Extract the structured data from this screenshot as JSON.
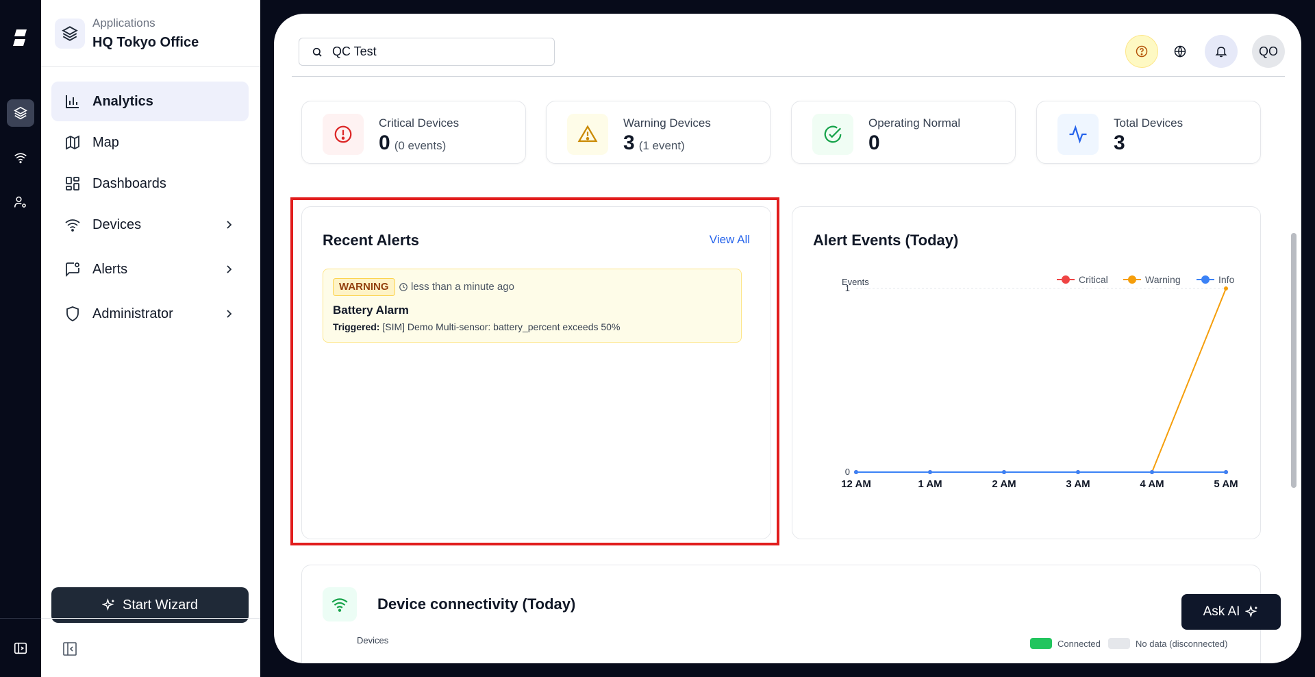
{
  "app": {
    "label": "Applications",
    "name": "HQ Tokyo Office"
  },
  "nav": [
    {
      "label": "Analytics",
      "icon": "bar-chart-icon",
      "active": true
    },
    {
      "label": "Map",
      "icon": "map-icon"
    },
    {
      "label": "Dashboards",
      "icon": "dashboard-grid-icon"
    },
    {
      "label": "Devices",
      "icon": "wifi-icon",
      "has_children": true
    },
    {
      "label": "Alerts",
      "icon": "message-alert-icon",
      "has_children": true
    },
    {
      "label": "Administrator",
      "icon": "shield-icon",
      "has_children": true
    }
  ],
  "wizard_label": "Start Wizard",
  "search": {
    "value": "QC Test"
  },
  "user_initials": "QO",
  "stats": [
    {
      "label": "Critical Devices",
      "value": "0",
      "sub": "(0 events)",
      "color": "#dc2626",
      "bg": "#fef2f2"
    },
    {
      "label": "Warning Devices",
      "value": "3",
      "sub": "(1 event)",
      "color": "#ca8a04",
      "bg": "#fefce8"
    },
    {
      "label": "Operating Normal",
      "value": "0",
      "sub": "",
      "color": "#16a34a",
      "bg": "#f0fdf4"
    },
    {
      "label": "Total Devices",
      "value": "3",
      "sub": "",
      "color": "#2563eb",
      "bg": "#eff6ff"
    }
  ],
  "recent_alerts": {
    "title": "Recent Alerts",
    "view_all": "View All",
    "items": [
      {
        "severity": "WARNING",
        "time": "less than a minute ago",
        "name": "Battery Alarm",
        "triggered_label": "Triggered:",
        "description": "[SIM] Demo Multi-sensor: battery_percent exceeds 50%"
      }
    ]
  },
  "alert_events": {
    "title": "Alert Events (Today)"
  },
  "chart_data": {
    "type": "line",
    "title": "Alert Events (Today)",
    "ylabel": "Events",
    "x": [
      "12 AM",
      "1 AM",
      "2 AM",
      "3 AM",
      "4 AM",
      "5 AM"
    ],
    "y_ticks": [
      "0",
      "1"
    ],
    "ylim": [
      0,
      1
    ],
    "legend_position": "top-right",
    "series": [
      {
        "name": "Critical",
        "color": "#ef4444",
        "values": [
          0,
          0,
          0,
          0,
          0,
          0
        ]
      },
      {
        "name": "Warning",
        "color": "#f59e0b",
        "values": [
          0,
          0,
          0,
          0,
          0,
          1
        ]
      },
      {
        "name": "Info",
        "color": "#3b82f6",
        "values": [
          0,
          0,
          0,
          0,
          0,
          0
        ]
      }
    ]
  },
  "connectivity": {
    "title": "Device connectivity (Today)",
    "axis_label": "Devices",
    "legend": [
      {
        "label": "Connected",
        "color": "#22c55e"
      },
      {
        "label": "No data (disconnected)",
        "color": "#e5e7eb"
      }
    ]
  },
  "ask_ai_label": "Ask AI"
}
